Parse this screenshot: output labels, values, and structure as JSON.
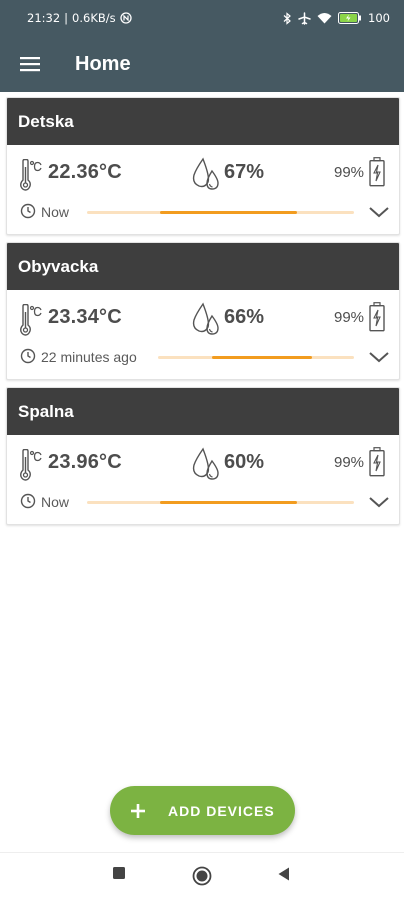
{
  "status_bar": {
    "time": "21:32",
    "network_speed": "0.6KB/s",
    "battery_percent": "100",
    "icons": [
      "nfc-icon",
      "bluetooth-icon",
      "airplane-icon",
      "wifi-icon",
      "battery-charging-icon"
    ]
  },
  "app_bar": {
    "title": "Home",
    "menu_icon": "hamburger-menu-icon"
  },
  "devices": [
    {
      "name": "Detska",
      "temperature": "22.36°C",
      "humidity": "67%",
      "battery": "99%",
      "updated": "Now"
    },
    {
      "name": "Obyvacka",
      "temperature": "23.34°C",
      "humidity": "66%",
      "battery": "99%",
      "updated": "22 minutes ago"
    },
    {
      "name": "Spalna",
      "temperature": "23.96°C",
      "humidity": "60%",
      "battery": "99%",
      "updated": "Now"
    }
  ],
  "fab": {
    "label": "ADD DEVICES",
    "icon": "plus-icon",
    "color": "#7cb342"
  },
  "colors": {
    "app_bar": "#465962",
    "card_header": "#3e3e3e",
    "progress_fill": "#f29c1f",
    "progress_track": "#fbe1bf"
  },
  "nav_bar": {
    "icons": [
      "recents-square-icon",
      "home-circle-icon",
      "back-triangle-icon"
    ]
  }
}
